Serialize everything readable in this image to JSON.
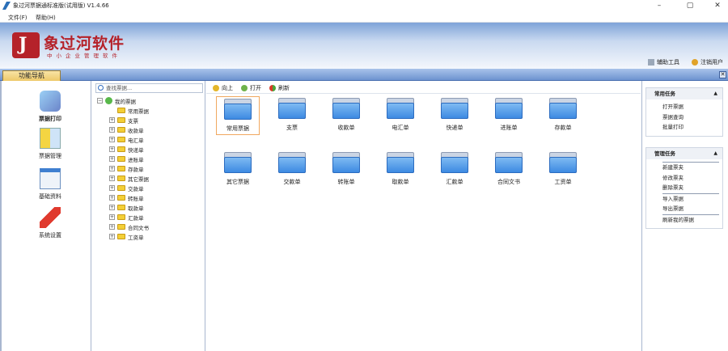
{
  "window": {
    "title": "象过河票据通标准版(试用版) V1.4.66",
    "controls": [
      "–",
      "▢",
      "✕"
    ]
  },
  "menu": [
    "文件(F)",
    "帮助(H)"
  ],
  "banner": {
    "logo_text": "象过河软件",
    "logo_sub": "中小企业管理软件",
    "tools": [
      "辅助工具",
      "注销用户"
    ]
  },
  "tab": {
    "label": "功能导航",
    "close": "✕"
  },
  "nav": [
    "票据打印",
    "票据管理",
    "基础资料",
    "系统设置"
  ],
  "tree": {
    "search_placeholder": "查找票据...",
    "root": "我的票据",
    "items": [
      "常用票据",
      "支票",
      "收款单",
      "电汇单",
      "快递单",
      "进账单",
      "存款单",
      "其它票据",
      "交款单",
      "转账单",
      "取款单",
      "汇款单",
      "合同文书",
      "工资单"
    ]
  },
  "toolbar": [
    "向上",
    "打开",
    "刷新"
  ],
  "folders": [
    "常用票据",
    "支票",
    "收款单",
    "电汇单",
    "快递单",
    "进账单",
    "存款单",
    "其它票据",
    "交款单",
    "转账单",
    "取款单",
    "汇款单",
    "合同文书",
    "工资单"
  ],
  "tasks": {
    "common": {
      "title": "常用任务",
      "items": [
        "打开票据",
        "票据查询",
        "批量打印"
      ]
    },
    "manage": {
      "title": "管理任务",
      "items": [
        "新建票夹",
        "修改票夹",
        "删除票夹",
        "导入票据",
        "导出票据",
        "刷新我的票据"
      ]
    }
  },
  "colors": {
    "accent": "#b5222a",
    "folder": "#3d8ae2",
    "selection": "#f0a860"
  }
}
